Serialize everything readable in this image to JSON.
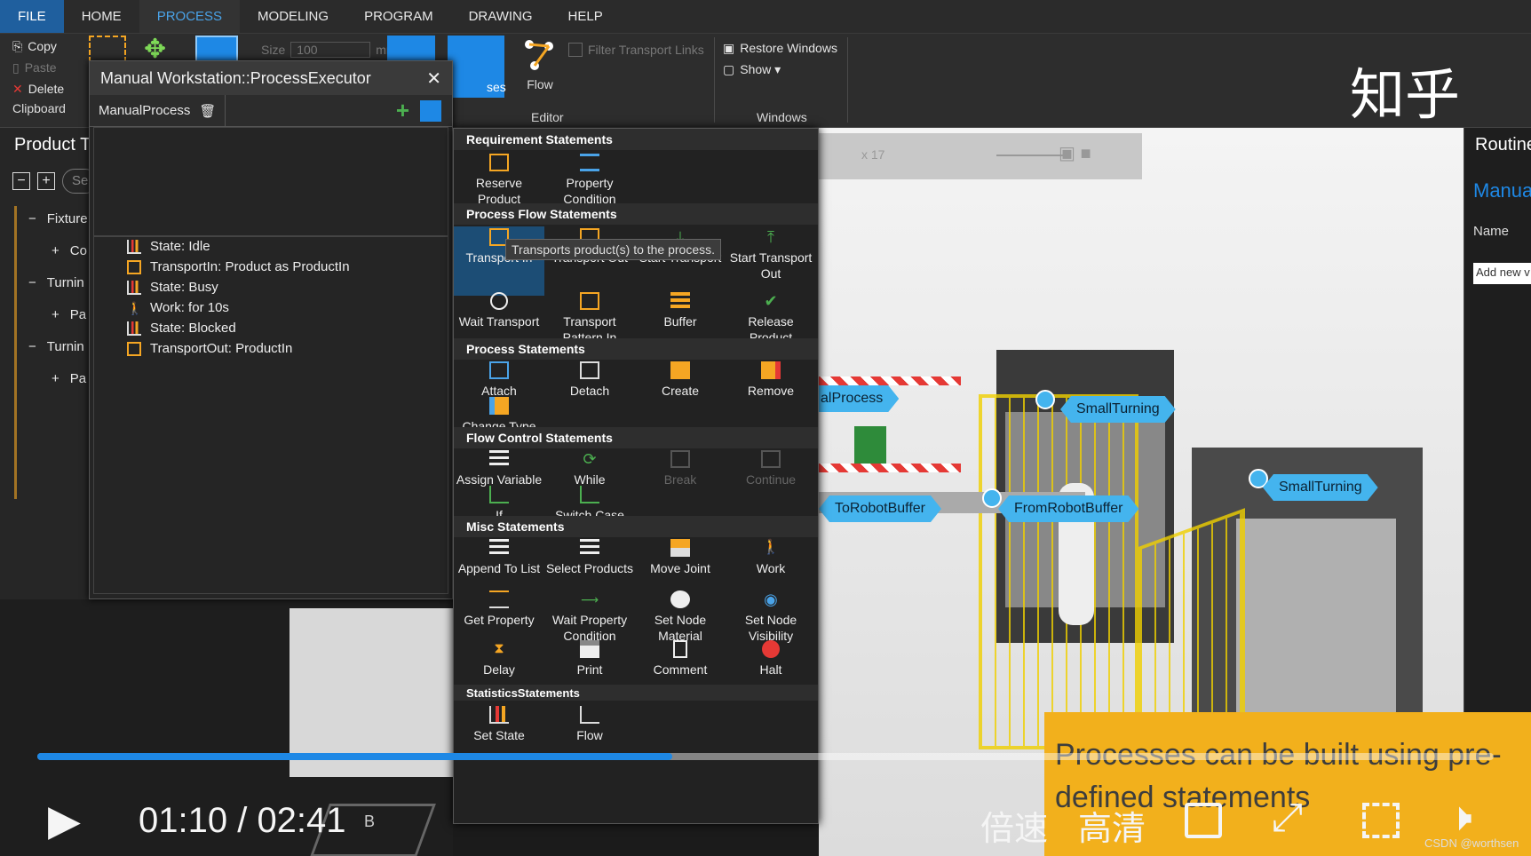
{
  "menu": {
    "tabs": [
      "FILE",
      "HOME",
      "PROCESS",
      "MODELING",
      "PROGRAM",
      "DRAWING",
      "HELP"
    ],
    "active": "PROCESS"
  },
  "ribbon": {
    "clipboard": {
      "copy": "Copy",
      "paste": "Paste",
      "delete": "Delete",
      "group": "Clipboard"
    },
    "size_label": "Size",
    "size_value": "100",
    "size_unit": "mm",
    "ses": "ses",
    "flow": "Flow",
    "filter": "Filter Transport Links",
    "editor": "Editor",
    "restore": "Restore Windows",
    "show": "Show ▾",
    "windows": "Windows"
  },
  "watermark": "知乎",
  "product_panel": {
    "title": "Product T",
    "search_placeholder": "Se",
    "items": [
      {
        "sign": "−",
        "label": "Fixture"
      },
      {
        "sign": "+",
        "label": "Co"
      },
      {
        "sign": "−",
        "label": "Turnin"
      },
      {
        "sign": "+",
        "label": "Pa"
      },
      {
        "sign": "−",
        "label": "Turnin"
      },
      {
        "sign": "+",
        "label": "Pa"
      }
    ]
  },
  "executor": {
    "title": "Manual Workstation::ProcessExecutor",
    "process_tab": "ManualProcess",
    "statements": [
      {
        "icon": "chart-icon",
        "label": "State: Idle"
      },
      {
        "icon": "transport-in-icon",
        "label": "TransportIn: Product as ProductIn"
      },
      {
        "icon": "chart-icon",
        "label": "State: Busy"
      },
      {
        "icon": "worker-icon",
        "label": "Work: for 10s"
      },
      {
        "icon": "chart-icon",
        "label": "State: Blocked"
      },
      {
        "icon": "transport-out-icon",
        "label": "TransportOut: ProductIn"
      }
    ]
  },
  "palette": {
    "categories": {
      "requirement": "Requirement Statements",
      "flow": "Process Flow Statements",
      "process": "Process Statements",
      "control": "Flow Control Statements",
      "misc": "Misc Statements",
      "statistics": "StatisticsStatements"
    },
    "requirement": [
      "Reserve Product",
      "Property Condition"
    ],
    "flow_row1": [
      "Transport In",
      "Transport Out",
      "Start Transport",
      "Start Transport Out"
    ],
    "flow_row2": [
      "Wait Transport",
      "Transport Pattern In",
      "Buffer",
      "Release Product Reservation"
    ],
    "process_row1": [
      "Attach",
      "Detach",
      "Create",
      "Remove"
    ],
    "process_row2": [
      "Change Type"
    ],
    "control_row1": [
      "Assign Variable",
      "While",
      "Break",
      "Continue"
    ],
    "control_row2": [
      "If",
      "Switch Case"
    ],
    "misc_row1": [
      "Append To List",
      "Select Products",
      "Move Joint",
      "Work"
    ],
    "misc_row2": [
      "Get Property",
      "Wait Property Condition",
      "Set Node Material",
      "Set Node Visibility"
    ],
    "misc_row3": [
      "Delay",
      "Print",
      "Comment",
      "Halt"
    ],
    "statistics": [
      "Set State",
      "Flow"
    ],
    "tooltip": "Transports product(s) to the process."
  },
  "viewport": {
    "zoom": "x 17",
    "nodes": [
      "alProcess",
      "SmallTurning",
      "SmallTurning",
      "ToRobotBuffer",
      "FromRobotBuffer"
    ],
    "accent": "#44b4ee"
  },
  "routine_panel": {
    "title": "Routine",
    "subtitle": "Manua",
    "name_label": "Name",
    "add_new": "Add new v"
  },
  "video": {
    "time": "01:10 / 02:41",
    "progress": 0.436,
    "speed": "倍速",
    "quality": "高清",
    "subtitle": "Processes can be built using pre-defined statements",
    "credit": "CSDN @worthsen",
    "accent": "#1e88e5"
  },
  "bottom": {
    "cube_label": "B"
  }
}
